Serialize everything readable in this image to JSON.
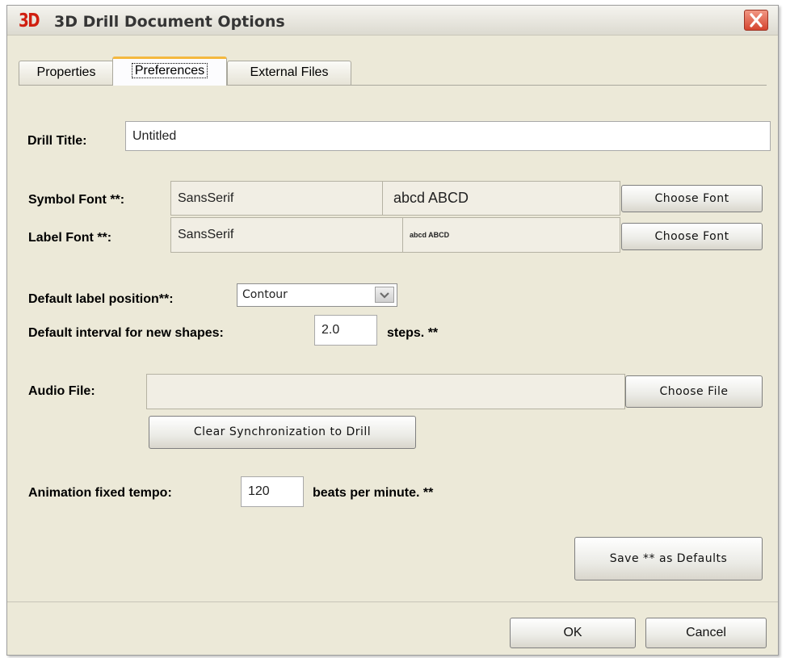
{
  "window": {
    "logo_text": "3D",
    "title": "3D Drill Document Options"
  },
  "tabs": [
    {
      "label": "Properties"
    },
    {
      "label": "Preferences"
    },
    {
      "label": "External Files"
    }
  ],
  "drill_title": {
    "label": "Drill Title:",
    "value": "Untitled"
  },
  "symbol_font": {
    "label": "Symbol Font **:",
    "name": "SansSerif",
    "sample": "abcd ABCD",
    "button": "Choose Font"
  },
  "label_font": {
    "label": "Label Font **:",
    "name": "SansSerif",
    "sample": "abcd ABCD",
    "button": "Choose Font"
  },
  "label_position": {
    "label": "Default label position**:",
    "value": "Contour"
  },
  "interval": {
    "label": "Default interval for new shapes:",
    "value": "2.0",
    "suffix": "steps. **"
  },
  "audio": {
    "label": "Audio File:",
    "value": "",
    "choose_button": "Choose File",
    "clear_button": "Clear Synchronization to Drill"
  },
  "tempo": {
    "label": "Animation fixed tempo:",
    "value": "120",
    "suffix": "beats per minute. **"
  },
  "save_defaults_button": "Save ** as Defaults",
  "footer": {
    "ok": "OK",
    "cancel": "Cancel"
  },
  "colors": {
    "logo": "#d01f10",
    "active_tab_accent": "#f4b83f",
    "close_button": "#d5452f",
    "dialog_bg": "#ece9d8"
  }
}
